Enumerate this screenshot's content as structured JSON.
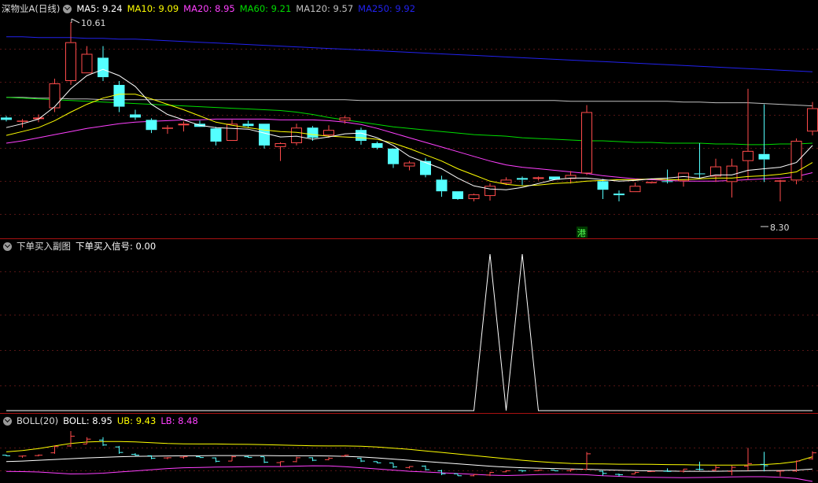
{
  "colors": {
    "up": "#ff4b4b",
    "down": "#54ffff",
    "ma5": "#ffffff",
    "ma10": "#ffff00",
    "ma20": "#ff40ff",
    "ma60": "#00dd00",
    "ma120": "#c0c0c0",
    "ma250": "#2222ee",
    "label": "#dddddd",
    "separator": "#aa1111"
  },
  "main_panel": {
    "title": "深物业A(日线)",
    "legend": [
      {
        "label": "MA5: 9.24",
        "color": "#ffffff"
      },
      {
        "label": "MA10: 9.09",
        "color": "#ffff00"
      },
      {
        "label": "MA20: 8.95",
        "color": "#ff40ff"
      },
      {
        "label": "MA60: 9.21",
        "color": "#00dd00"
      },
      {
        "label": "MA120: 9.57",
        "color": "#c0c0c0"
      },
      {
        "label": "MA250: 9.92",
        "color": "#2222ee"
      }
    ],
    "high_label": "10.61",
    "low_label": "8.30",
    "badge": "港"
  },
  "sub_panel": {
    "title": "下单买入副图",
    "legend_label": "下单买入信号: 0.00"
  },
  "boll_panel": {
    "title": "BOLL(20)",
    "legend": [
      {
        "label": "BOLL: 8.95",
        "color": "#ffffff"
      },
      {
        "label": "UB: 9.43",
        "color": "#ffff00"
      },
      {
        "label": "LB: 8.48",
        "color": "#ff40ff"
      }
    ]
  },
  "chart_data": {
    "type": "candlestick",
    "candles": [
      [
        9.38,
        9.4,
        9.33,
        9.35
      ],
      [
        9.33,
        9.36,
        9.25,
        9.34
      ],
      [
        9.36,
        9.42,
        9.32,
        9.38
      ],
      [
        9.5,
        9.88,
        9.45,
        9.82
      ],
      [
        9.85,
        10.61,
        9.8,
        10.35
      ],
      [
        9.95,
        10.3,
        9.95,
        10.2
      ],
      [
        10.15,
        10.3,
        9.85,
        9.9
      ],
      [
        9.8,
        9.85,
        9.45,
        9.52
      ],
      [
        9.42,
        9.48,
        9.35,
        9.38
      ],
      [
        9.35,
        9.37,
        9.18,
        9.22
      ],
      [
        9.24,
        9.28,
        9.17,
        9.25
      ],
      [
        9.28,
        9.33,
        9.2,
        9.3
      ],
      [
        9.3,
        9.34,
        9.27,
        9.26
      ],
      [
        9.24,
        9.26,
        9.02,
        9.07
      ],
      [
        9.08,
        9.35,
        9.08,
        9.3
      ],
      [
        9.3,
        9.34,
        9.25,
        9.27
      ],
      [
        9.3,
        9.3,
        8.98,
        9.02
      ],
      [
        9.0,
        9.06,
        8.82,
        9.05
      ],
      [
        9.05,
        9.3,
        9.02,
        9.25
      ],
      [
        9.25,
        9.27,
        9.08,
        9.12
      ],
      [
        9.15,
        9.28,
        9.12,
        9.22
      ],
      [
        9.34,
        9.4,
        9.3,
        9.38
      ],
      [
        9.22,
        9.25,
        9.03,
        9.08
      ],
      [
        9.05,
        9.07,
        8.97,
        8.99
      ],
      [
        8.98,
        8.98,
        8.73,
        8.78
      ],
      [
        8.75,
        8.82,
        8.7,
        8.8
      ],
      [
        8.82,
        8.86,
        8.61,
        8.64
      ],
      [
        8.58,
        8.63,
        8.36,
        8.43
      ],
      [
        8.43,
        8.43,
        8.32,
        8.33
      ],
      [
        8.33,
        8.4,
        8.3,
        8.39
      ],
      [
        8.37,
        8.53,
        8.31,
        8.5
      ],
      [
        8.53,
        8.61,
        8.51,
        8.58
      ],
      [
        8.6,
        8.62,
        8.51,
        8.58
      ],
      [
        8.59,
        8.62,
        8.57,
        8.61
      ],
      [
        8.62,
        8.62,
        8.58,
        8.58
      ],
      [
        8.59,
        8.69,
        8.53,
        8.64
      ],
      [
        8.66,
        9.54,
        8.64,
        9.45
      ],
      [
        8.56,
        8.59,
        8.33,
        8.45
      ],
      [
        8.4,
        8.44,
        8.3,
        8.38
      ],
      [
        8.42,
        8.54,
        8.42,
        8.5
      ],
      [
        8.54,
        8.55,
        8.53,
        8.55
      ],
      [
        8.56,
        8.71,
        8.53,
        8.55
      ],
      [
        8.56,
        8.67,
        8.49,
        8.67
      ],
      [
        8.66,
        9.05,
        8.6,
        8.65
      ],
      [
        8.62,
        8.85,
        8.55,
        8.75
      ],
      [
        8.55,
        8.85,
        8.35,
        8.76
      ],
      [
        8.82,
        9.75,
        8.58,
        8.95
      ],
      [
        8.91,
        9.55,
        8.55,
        8.84
      ],
      [
        8.56,
        8.58,
        8.3,
        8.57
      ],
      [
        8.57,
        9.11,
        8.52,
        9.08
      ],
      [
        9.2,
        9.58,
        9.15,
        9.5
      ]
    ],
    "ma5": [
      9.25,
      9.3,
      9.36,
      9.52,
      9.75,
      9.92,
      10.0,
      9.92,
      9.78,
      9.55,
      9.42,
      9.35,
      9.28,
      9.25,
      9.24,
      9.23,
      9.18,
      9.13,
      9.14,
      9.1,
      9.13,
      9.17,
      9.18,
      9.12,
      9.02,
      8.88,
      8.8,
      8.72,
      8.6,
      8.5,
      8.46,
      8.45,
      8.48,
      8.53,
      8.58,
      8.6,
      8.6,
      8.58,
      8.56,
      8.57,
      8.59,
      8.6,
      8.62,
      8.6,
      8.64,
      8.64,
      8.7,
      8.72,
      8.74,
      8.8,
      9.02
    ],
    "ma10": [
      9.15,
      9.2,
      9.25,
      9.34,
      9.45,
      9.55,
      9.63,
      9.68,
      9.68,
      9.62,
      9.55,
      9.48,
      9.4,
      9.32,
      9.28,
      9.25,
      9.22,
      9.2,
      9.19,
      9.16,
      9.14,
      9.13,
      9.12,
      9.1,
      9.05,
      8.98,
      8.9,
      8.82,
      8.72,
      8.64,
      8.56,
      8.52,
      8.5,
      8.51,
      8.53,
      8.54,
      8.56,
      8.57,
      8.58,
      8.58,
      8.59,
      8.58,
      8.58,
      8.59,
      8.6,
      8.6,
      8.62,
      8.63,
      8.65,
      8.68,
      8.8
    ],
    "ma20": [
      9.05,
      9.08,
      9.12,
      9.16,
      9.2,
      9.24,
      9.27,
      9.3,
      9.32,
      9.33,
      9.34,
      9.35,
      9.35,
      9.36,
      9.36,
      9.36,
      9.36,
      9.35,
      9.35,
      9.35,
      9.34,
      9.32,
      9.29,
      9.24,
      9.18,
      9.12,
      9.06,
      9.0,
      8.94,
      8.88,
      8.82,
      8.77,
      8.74,
      8.72,
      8.7,
      8.68,
      8.66,
      8.63,
      8.61,
      8.59,
      8.58,
      8.57,
      8.56,
      8.56,
      8.56,
      8.57,
      8.58,
      8.59,
      8.6,
      8.62,
      8.67
    ],
    "ma60": [
      9.64,
      9.63,
      9.62,
      9.61,
      9.6,
      9.59,
      9.58,
      9.57,
      9.56,
      9.55,
      9.54,
      9.53,
      9.52,
      9.51,
      9.5,
      9.49,
      9.48,
      9.47,
      9.45,
      9.42,
      9.38,
      9.35,
      9.32,
      9.29,
      9.26,
      9.24,
      9.22,
      9.2,
      9.18,
      9.16,
      9.15,
      9.14,
      9.12,
      9.11,
      9.1,
      9.09,
      9.08,
      9.08,
      9.07,
      9.06,
      9.06,
      9.05,
      9.05,
      9.05,
      9.04,
      9.04,
      9.03,
      9.03,
      9.04,
      9.04,
      9.05
    ],
    "ma120": [
      9.64,
      9.64,
      9.63,
      9.63,
      9.62,
      9.62,
      9.61,
      9.61,
      9.61,
      9.61,
      9.61,
      9.61,
      9.61,
      9.61,
      9.61,
      9.61,
      9.61,
      9.61,
      9.61,
      9.61,
      9.61,
      9.61,
      9.6,
      9.6,
      9.6,
      9.6,
      9.6,
      9.6,
      9.6,
      9.6,
      9.6,
      9.6,
      9.6,
      9.6,
      9.6,
      9.59,
      9.59,
      9.59,
      9.59,
      9.59,
      9.59,
      9.59,
      9.58,
      9.58,
      9.57,
      9.57,
      9.57,
      9.56,
      9.55,
      9.54,
      9.53
    ],
    "ma250": [
      10.42,
      10.42,
      10.41,
      10.41,
      10.41,
      10.4,
      10.4,
      10.39,
      10.39,
      10.38,
      10.37,
      10.36,
      10.35,
      10.34,
      10.33,
      10.32,
      10.31,
      10.3,
      10.29,
      10.28,
      10.27,
      10.26,
      10.25,
      10.24,
      10.23,
      10.22,
      10.21,
      10.2,
      10.19,
      10.18,
      10.17,
      10.16,
      10.15,
      10.14,
      10.13,
      10.12,
      10.11,
      10.1,
      10.09,
      10.08,
      10.07,
      10.06,
      10.05,
      10.04,
      10.03,
      10.02,
      10.01,
      10.0,
      9.99,
      9.98,
      9.97
    ],
    "signal": [
      0,
      0,
      0,
      0,
      0,
      0,
      0,
      0,
      0,
      0,
      0,
      0,
      0,
      0,
      0,
      0,
      0,
      0,
      0,
      0,
      0,
      0,
      0,
      0,
      0,
      0,
      0,
      0,
      0,
      0,
      1,
      0,
      1,
      0,
      0,
      0,
      0,
      0,
      0,
      0,
      0,
      0,
      0,
      0,
      0,
      0,
      0,
      0,
      0,
      0,
      0
    ],
    "boll_mid": [
      9.05,
      9.08,
      9.12,
      9.16,
      9.2,
      9.24,
      9.27,
      9.3,
      9.32,
      9.33,
      9.34,
      9.35,
      9.35,
      9.36,
      9.36,
      9.36,
      9.36,
      9.35,
      9.35,
      9.35,
      9.34,
      9.32,
      9.29,
      9.24,
      9.18,
      9.12,
      9.06,
      9.0,
      8.94,
      8.88,
      8.82,
      8.77,
      8.74,
      8.72,
      8.7,
      8.68,
      8.66,
      8.63,
      8.61,
      8.59,
      8.58,
      8.57,
      8.56,
      8.56,
      8.56,
      8.57,
      8.58,
      8.59,
      8.6,
      8.62,
      8.67
    ],
    "boll_ub": [
      9.55,
      9.62,
      9.72,
      9.85,
      9.98,
      10.05,
      10.08,
      10.08,
      10.06,
      10.02,
      9.98,
      9.96,
      9.95,
      9.95,
      9.94,
      9.93,
      9.92,
      9.9,
      9.88,
      9.86,
      9.85,
      9.85,
      9.84,
      9.8,
      9.74,
      9.68,
      9.6,
      9.52,
      9.44,
      9.36,
      9.28,
      9.2,
      9.12,
      9.05,
      9.0,
      8.96,
      8.94,
      8.93,
      8.92,
      8.92,
      8.91,
      8.9,
      8.89,
      8.88,
      8.87,
      8.87,
      8.88,
      8.9,
      8.95,
      9.05,
      9.3
    ],
    "boll_lb": [
      8.55,
      8.54,
      8.52,
      8.47,
      8.42,
      8.43,
      8.46,
      8.52,
      8.58,
      8.64,
      8.7,
      8.74,
      8.75,
      8.77,
      8.78,
      8.79,
      8.8,
      8.8,
      8.82,
      8.84,
      8.83,
      8.79,
      8.74,
      8.68,
      8.62,
      8.56,
      8.52,
      8.48,
      8.44,
      8.4,
      8.36,
      8.34,
      8.36,
      8.39,
      8.4,
      8.4,
      8.38,
      8.33,
      8.3,
      8.26,
      8.25,
      8.24,
      8.23,
      8.24,
      8.25,
      8.27,
      8.28,
      8.28,
      8.25,
      8.19,
      8.04
    ]
  }
}
